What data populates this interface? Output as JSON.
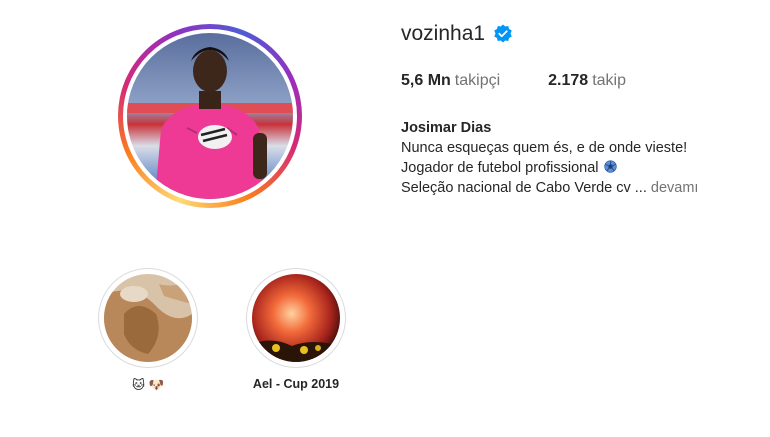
{
  "profile": {
    "username": "vozinha1",
    "verified": true,
    "followers_count": "5,6 Mn",
    "followers_label": "takipçi",
    "following_count": "2.178",
    "following_label": "takip",
    "full_name": "Josimar Dias",
    "bio_lines": [
      "Nunca esqueças quem és, e de onde vieste!",
      "Jogador de futebol profissional",
      "Seleção nacional de Cabo Verde cv ..."
    ],
    "more_label": "devamı"
  },
  "highlights": [
    {
      "label": "🐱 🐶"
    },
    {
      "label": "Ael - Cup 2019"
    }
  ],
  "colors": {
    "verified_blue": "#0095f6",
    "text": "#262626",
    "secondary": "#737373"
  },
  "icons": {
    "verified": "verified-badge-icon",
    "globe": "soccer-ball-icon"
  }
}
